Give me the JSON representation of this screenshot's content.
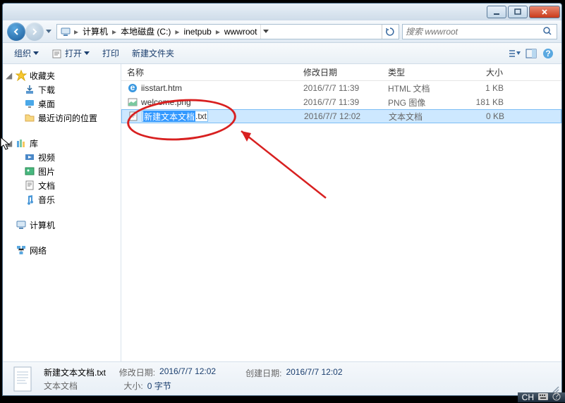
{
  "titlebar": {},
  "nav": {
    "breadcrumb": [
      "计算机",
      "本地磁盘 (C:)",
      "inetpub",
      "wwwroot"
    ],
    "search_placeholder": "搜索 wwwroot"
  },
  "toolbar": {
    "organize": "组织",
    "open": "打开",
    "print": "打印",
    "new_folder": "新建文件夹"
  },
  "columns": {
    "name": "名称",
    "date": "修改日期",
    "type": "类型",
    "size": "大小"
  },
  "sidebar": {
    "favorites": {
      "label": "收藏夹",
      "items": [
        "下载",
        "桌面",
        "最近访问的位置"
      ]
    },
    "libraries": {
      "label": "库",
      "items": [
        "视频",
        "图片",
        "文档",
        "音乐"
      ]
    },
    "computer": {
      "label": "计算机"
    },
    "network": {
      "label": "网络"
    }
  },
  "files": [
    {
      "icon": "ie",
      "name": "iisstart.htm",
      "date": "2016/7/7 11:39",
      "type": "HTML 文档",
      "size": "1 KB"
    },
    {
      "icon": "png",
      "name": "welcome.png",
      "date": "2016/7/7 11:39",
      "type": "PNG 图像",
      "size": "181 KB"
    },
    {
      "icon": "txt",
      "name_sel": "新建文本文档",
      "name_ext": ".txt",
      "date": "2016/7/7 12:02",
      "type": "文本文档",
      "size": "0 KB",
      "editing": true
    }
  ],
  "status": {
    "filename": "新建文本文档.txt",
    "filetype": "文本文档",
    "mod_label": "修改日期:",
    "mod_val": "2016/7/7 12:02",
    "size_label": "大小:",
    "size_val": "0 字节",
    "create_label": "创建日期:",
    "create_val": "2016/7/7 12:02"
  },
  "taskbar": {
    "ime": "CH"
  }
}
